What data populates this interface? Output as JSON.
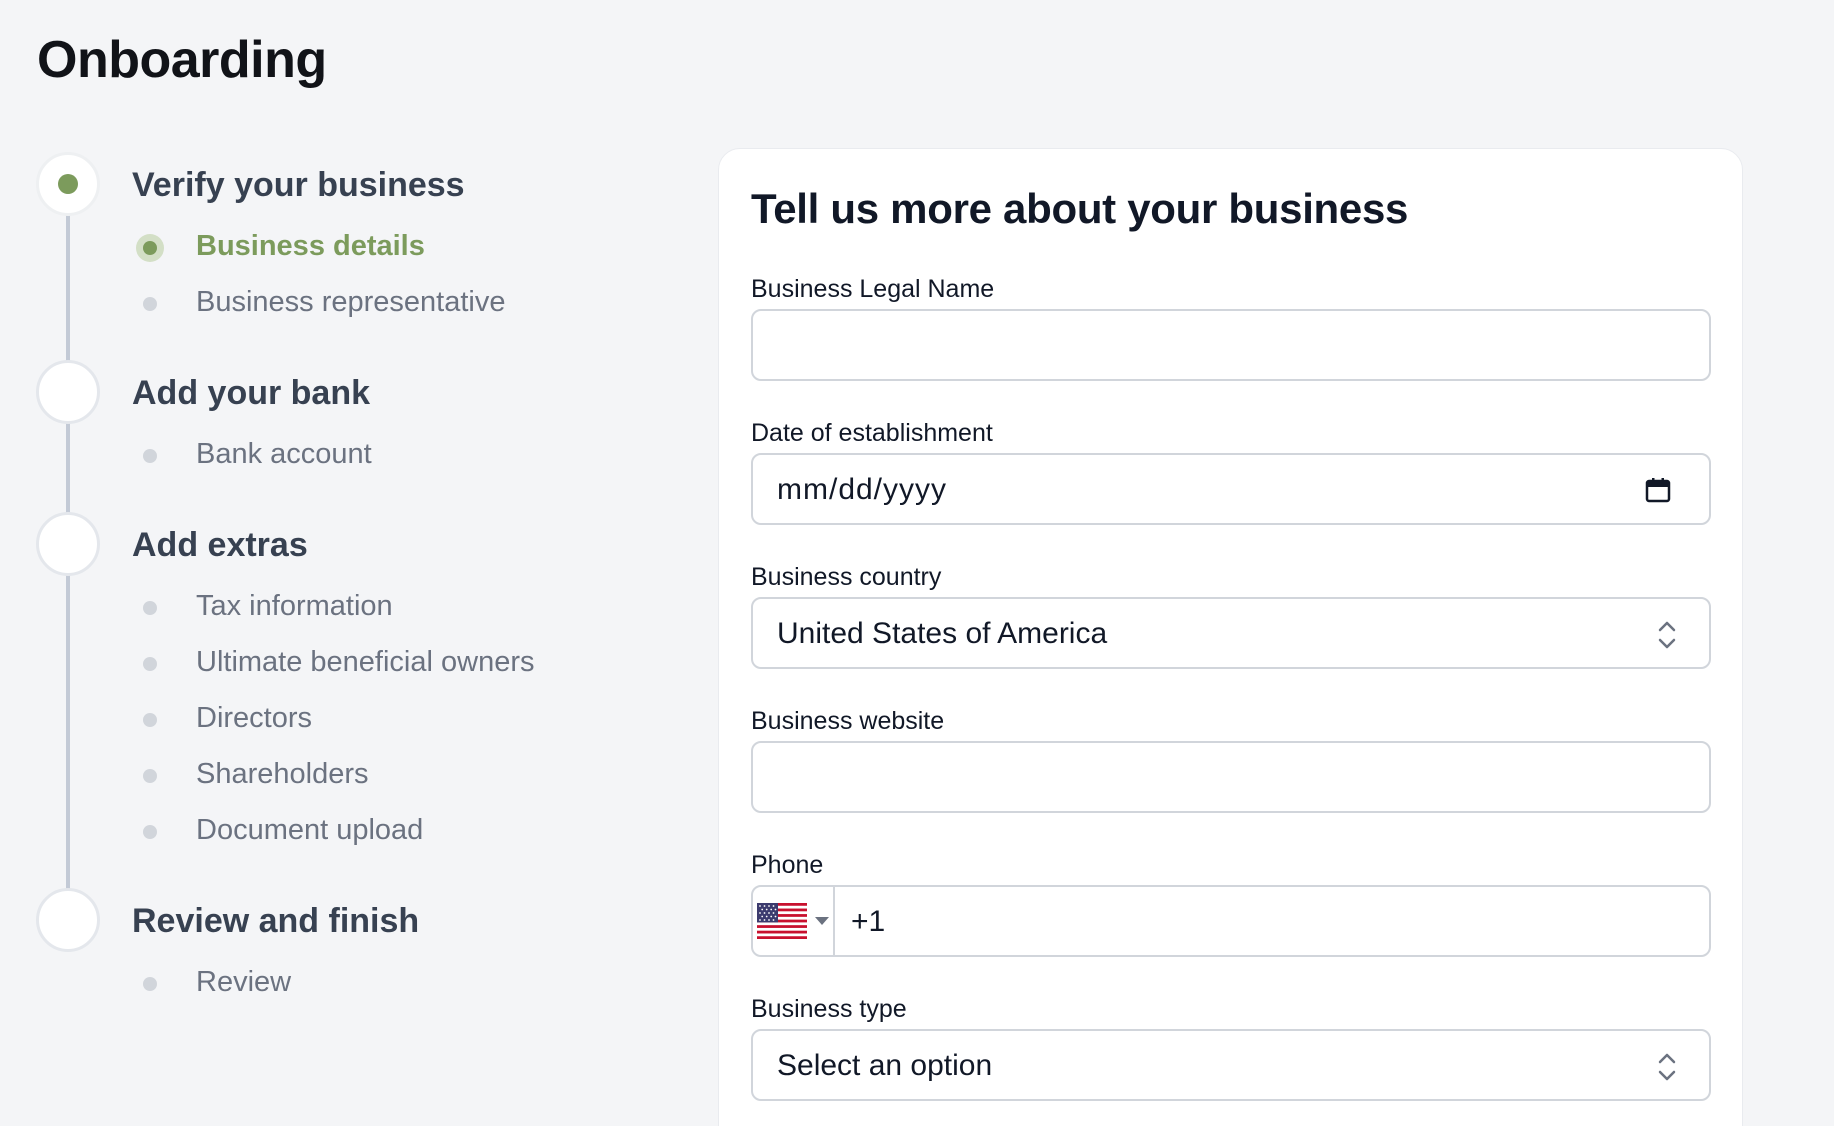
{
  "page": {
    "title": "Onboarding"
  },
  "stepper": {
    "steps": [
      {
        "title": "Verify your business",
        "state": "active",
        "items": [
          {
            "label": "Business details",
            "state": "active"
          },
          {
            "label": "Business representative",
            "state": "pending"
          }
        ]
      },
      {
        "title": "Add your bank",
        "state": "pending",
        "items": [
          {
            "label": "Bank account",
            "state": "pending"
          }
        ]
      },
      {
        "title": "Add extras",
        "state": "pending",
        "items": [
          {
            "label": "Tax information",
            "state": "pending"
          },
          {
            "label": "Ultimate beneficial owners",
            "state": "pending"
          },
          {
            "label": "Directors",
            "state": "pending"
          },
          {
            "label": "Shareholders",
            "state": "pending"
          },
          {
            "label": "Document upload",
            "state": "pending"
          }
        ]
      },
      {
        "title": "Review and finish",
        "state": "pending",
        "items": [
          {
            "label": "Review",
            "state": "pending"
          }
        ]
      }
    ]
  },
  "form": {
    "title": "Tell us more about your business",
    "fields": {
      "legal_name": {
        "label": "Business Legal Name",
        "value": ""
      },
      "establishment_date": {
        "label": "Date of establishment",
        "value": "mm/dd/yyyy",
        "icon": "calendar-icon"
      },
      "country": {
        "label": "Business country",
        "value": "United States of America",
        "icon": "up-down-chevron-icon"
      },
      "website": {
        "label": "Business website",
        "value": ""
      },
      "phone": {
        "label": "Phone",
        "prefix": "+1",
        "flag": "us-flag-icon",
        "value": ""
      },
      "business_type": {
        "label": "Business type",
        "value": "Select an option",
        "icon": "up-down-chevron-icon"
      }
    }
  },
  "colors": {
    "accent": "#7c9b5c",
    "accent_light": "#d3dfc6",
    "background": "#f4f5f7",
    "rail": "#c3cad6",
    "muted_text": "#6b7280"
  }
}
